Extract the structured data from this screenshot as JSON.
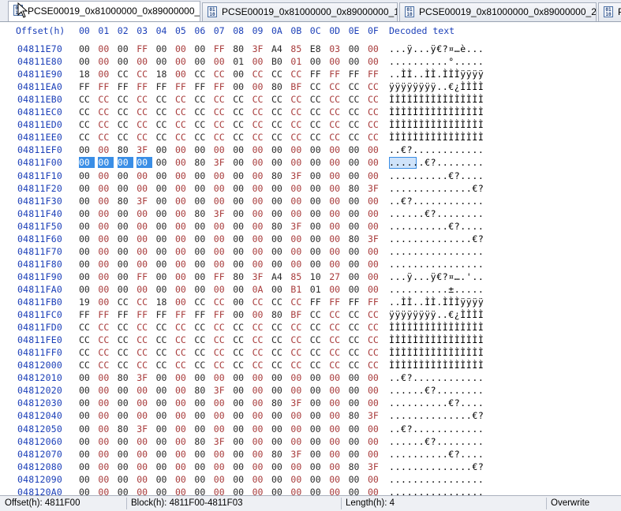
{
  "tabs": [
    {
      "label": "PCSE00019_0x81000000_0x89000000_0.bin",
      "active": true
    },
    {
      "label": "PCSE00019_0x81000000_0x89000000_1.bin",
      "active": false
    },
    {
      "label": "PCSE00019_0x81000000_0x89000000_2.bin",
      "active": false
    },
    {
      "label": "P",
      "active": false
    }
  ],
  "header": {
    "offset_label": "Offset(h)",
    "columns": [
      "00",
      "01",
      "02",
      "03",
      "04",
      "05",
      "06",
      "07",
      "08",
      "09",
      "0A",
      "0B",
      "0C",
      "0D",
      "0E",
      "0F"
    ],
    "decoded_label": "Decoded text"
  },
  "rows": [
    {
      "offset": "04811E70",
      "bytes": [
        "00",
        "00",
        "00",
        "FF",
        "00",
        "00",
        "00",
        "FF",
        "80",
        "3F",
        "A4",
        "85",
        "E8",
        "03",
        "00",
        "00"
      ],
      "text": "...ÿ...ÿ€?¤…è..."
    },
    {
      "offset": "04811E80",
      "bytes": [
        "00",
        "00",
        "00",
        "00",
        "00",
        "00",
        "00",
        "00",
        "01",
        "00",
        "B0",
        "01",
        "00",
        "00",
        "00",
        "00"
      ],
      "text": "..........°....."
    },
    {
      "offset": "04811E90",
      "bytes": [
        "18",
        "00",
        "CC",
        "CC",
        "18",
        "00",
        "CC",
        "CC",
        "00",
        "CC",
        "CC",
        "CC",
        "FF",
        "FF",
        "FF",
        "FF"
      ],
      "text": "..ÌÌ..ÌÌ.ÌÌÌÿÿÿÿ"
    },
    {
      "offset": "04811EA0",
      "bytes": [
        "FF",
        "FF",
        "FF",
        "FF",
        "FF",
        "FF",
        "FF",
        "FF",
        "00",
        "00",
        "80",
        "BF",
        "CC",
        "CC",
        "CC",
        "CC"
      ],
      "text": "ÿÿÿÿÿÿÿÿ..€¿ÌÌÌÌ"
    },
    {
      "offset": "04811EB0",
      "bytes": [
        "CC",
        "CC",
        "CC",
        "CC",
        "CC",
        "CC",
        "CC",
        "CC",
        "CC",
        "CC",
        "CC",
        "CC",
        "CC",
        "CC",
        "CC",
        "CC"
      ],
      "text": "ÌÌÌÌÌÌÌÌÌÌÌÌÌÌÌÌ"
    },
    {
      "offset": "04811EC0",
      "bytes": [
        "CC",
        "CC",
        "CC",
        "CC",
        "CC",
        "CC",
        "CC",
        "CC",
        "CC",
        "CC",
        "CC",
        "CC",
        "CC",
        "CC",
        "CC",
        "CC"
      ],
      "text": "ÌÌÌÌÌÌÌÌÌÌÌÌÌÌÌÌ"
    },
    {
      "offset": "04811ED0",
      "bytes": [
        "CC",
        "CC",
        "CC",
        "CC",
        "CC",
        "CC",
        "CC",
        "CC",
        "CC",
        "CC",
        "CC",
        "CC",
        "CC",
        "CC",
        "CC",
        "CC"
      ],
      "text": "ÌÌÌÌÌÌÌÌÌÌÌÌÌÌÌÌ"
    },
    {
      "offset": "04811EE0",
      "bytes": [
        "CC",
        "CC",
        "CC",
        "CC",
        "CC",
        "CC",
        "CC",
        "CC",
        "CC",
        "CC",
        "CC",
        "CC",
        "CC",
        "CC",
        "CC",
        "CC"
      ],
      "text": "ÌÌÌÌÌÌÌÌÌÌÌÌÌÌÌÌ"
    },
    {
      "offset": "04811EF0",
      "bytes": [
        "00",
        "00",
        "80",
        "3F",
        "00",
        "00",
        "00",
        "00",
        "00",
        "00",
        "00",
        "00",
        "00",
        "00",
        "00",
        "00"
      ],
      "text": "..€?............"
    },
    {
      "offset": "04811F00",
      "bytes": [
        "00",
        "00",
        "00",
        "00",
        "00",
        "00",
        "80",
        "3F",
        "00",
        "00",
        "00",
        "00",
        "00",
        "00",
        "00",
        "00"
      ],
      "text": "......€?........"
    },
    {
      "offset": "04811F10",
      "bytes": [
        "00",
        "00",
        "00",
        "00",
        "00",
        "00",
        "00",
        "00",
        "00",
        "00",
        "80",
        "3F",
        "00",
        "00",
        "00",
        "00"
      ],
      "text": "..........€?...."
    },
    {
      "offset": "04811F20",
      "bytes": [
        "00",
        "00",
        "00",
        "00",
        "00",
        "00",
        "00",
        "00",
        "00",
        "00",
        "00",
        "00",
        "00",
        "00",
        "80",
        "3F"
      ],
      "text": "..............€?"
    },
    {
      "offset": "04811F30",
      "bytes": [
        "00",
        "00",
        "80",
        "3F",
        "00",
        "00",
        "00",
        "00",
        "00",
        "00",
        "00",
        "00",
        "00",
        "00",
        "00",
        "00"
      ],
      "text": "..€?............"
    },
    {
      "offset": "04811F40",
      "bytes": [
        "00",
        "00",
        "00",
        "00",
        "00",
        "00",
        "80",
        "3F",
        "00",
        "00",
        "00",
        "00",
        "00",
        "00",
        "00",
        "00"
      ],
      "text": "......€?........"
    },
    {
      "offset": "04811F50",
      "bytes": [
        "00",
        "00",
        "00",
        "00",
        "00",
        "00",
        "00",
        "00",
        "00",
        "00",
        "80",
        "3F",
        "00",
        "00",
        "00",
        "00"
      ],
      "text": "..........€?...."
    },
    {
      "offset": "04811F60",
      "bytes": [
        "00",
        "00",
        "00",
        "00",
        "00",
        "00",
        "00",
        "00",
        "00",
        "00",
        "00",
        "00",
        "00",
        "00",
        "80",
        "3F"
      ],
      "text": "..............€?"
    },
    {
      "offset": "04811F70",
      "bytes": [
        "00",
        "00",
        "00",
        "00",
        "00",
        "00",
        "00",
        "00",
        "00",
        "00",
        "00",
        "00",
        "00",
        "00",
        "00",
        "00"
      ],
      "text": "................"
    },
    {
      "offset": "04811F80",
      "bytes": [
        "00",
        "00",
        "00",
        "00",
        "00",
        "00",
        "00",
        "00",
        "00",
        "00",
        "00",
        "00",
        "00",
        "00",
        "00",
        "00"
      ],
      "text": "................"
    },
    {
      "offset": "04811F90",
      "bytes": [
        "00",
        "00",
        "00",
        "FF",
        "00",
        "00",
        "00",
        "FF",
        "80",
        "3F",
        "A4",
        "85",
        "10",
        "27",
        "00",
        "00"
      ],
      "text": "...ÿ...ÿ€?¤….'.."
    },
    {
      "offset": "04811FA0",
      "bytes": [
        "00",
        "00",
        "00",
        "00",
        "00",
        "00",
        "00",
        "00",
        "00",
        "0A",
        "00",
        "B1",
        "01",
        "00",
        "00",
        "00"
      ],
      "text": "..........±....."
    },
    {
      "offset": "04811FB0",
      "bytes": [
        "19",
        "00",
        "CC",
        "CC",
        "18",
        "00",
        "CC",
        "CC",
        "00",
        "CC",
        "CC",
        "CC",
        "FF",
        "FF",
        "FF",
        "FF"
      ],
      "text": "..ÌÌ..ÌÌ.ÌÌÌÿÿÿÿ"
    },
    {
      "offset": "04811FC0",
      "bytes": [
        "FF",
        "FF",
        "FF",
        "FF",
        "FF",
        "FF",
        "FF",
        "FF",
        "00",
        "00",
        "80",
        "BF",
        "CC",
        "CC",
        "CC",
        "CC"
      ],
      "text": "ÿÿÿÿÿÿÿÿ..€¿ÌÌÌÌ"
    },
    {
      "offset": "04811FD0",
      "bytes": [
        "CC",
        "CC",
        "CC",
        "CC",
        "CC",
        "CC",
        "CC",
        "CC",
        "CC",
        "CC",
        "CC",
        "CC",
        "CC",
        "CC",
        "CC",
        "CC"
      ],
      "text": "ÌÌÌÌÌÌÌÌÌÌÌÌÌÌÌÌ"
    },
    {
      "offset": "04811FE0",
      "bytes": [
        "CC",
        "CC",
        "CC",
        "CC",
        "CC",
        "CC",
        "CC",
        "CC",
        "CC",
        "CC",
        "CC",
        "CC",
        "CC",
        "CC",
        "CC",
        "CC"
      ],
      "text": "ÌÌÌÌÌÌÌÌÌÌÌÌÌÌÌÌ"
    },
    {
      "offset": "04811FF0",
      "bytes": [
        "CC",
        "CC",
        "CC",
        "CC",
        "CC",
        "CC",
        "CC",
        "CC",
        "CC",
        "CC",
        "CC",
        "CC",
        "CC",
        "CC",
        "CC",
        "CC"
      ],
      "text": "ÌÌÌÌÌÌÌÌÌÌÌÌÌÌÌÌ"
    },
    {
      "offset": "04812000",
      "bytes": [
        "CC",
        "CC",
        "CC",
        "CC",
        "CC",
        "CC",
        "CC",
        "CC",
        "CC",
        "CC",
        "CC",
        "CC",
        "CC",
        "CC",
        "CC",
        "CC"
      ],
      "text": "ÌÌÌÌÌÌÌÌÌÌÌÌÌÌÌÌ"
    },
    {
      "offset": "04812010",
      "bytes": [
        "00",
        "00",
        "80",
        "3F",
        "00",
        "00",
        "00",
        "00",
        "00",
        "00",
        "00",
        "00",
        "00",
        "00",
        "00",
        "00"
      ],
      "text": "..€?............"
    },
    {
      "offset": "04812020",
      "bytes": [
        "00",
        "00",
        "00",
        "00",
        "00",
        "00",
        "80",
        "3F",
        "00",
        "00",
        "00",
        "00",
        "00",
        "00",
        "00",
        "00"
      ],
      "text": "......€?........"
    },
    {
      "offset": "04812030",
      "bytes": [
        "00",
        "00",
        "00",
        "00",
        "00",
        "00",
        "00",
        "00",
        "00",
        "00",
        "80",
        "3F",
        "00",
        "00",
        "00",
        "00"
      ],
      "text": "..........€?...."
    },
    {
      "offset": "04812040",
      "bytes": [
        "00",
        "00",
        "00",
        "00",
        "00",
        "00",
        "00",
        "00",
        "00",
        "00",
        "00",
        "00",
        "00",
        "00",
        "80",
        "3F"
      ],
      "text": "..............€?"
    },
    {
      "offset": "04812050",
      "bytes": [
        "00",
        "00",
        "80",
        "3F",
        "00",
        "00",
        "00",
        "00",
        "00",
        "00",
        "00",
        "00",
        "00",
        "00",
        "00",
        "00"
      ],
      "text": "..€?............"
    },
    {
      "offset": "04812060",
      "bytes": [
        "00",
        "00",
        "00",
        "00",
        "00",
        "00",
        "80",
        "3F",
        "00",
        "00",
        "00",
        "00",
        "00",
        "00",
        "00",
        "00"
      ],
      "text": "......€?........"
    },
    {
      "offset": "04812070",
      "bytes": [
        "00",
        "00",
        "00",
        "00",
        "00",
        "00",
        "00",
        "00",
        "00",
        "00",
        "80",
        "3F",
        "00",
        "00",
        "00",
        "00"
      ],
      "text": "..........€?...."
    },
    {
      "offset": "04812080",
      "bytes": [
        "00",
        "00",
        "00",
        "00",
        "00",
        "00",
        "00",
        "00",
        "00",
        "00",
        "00",
        "00",
        "00",
        "00",
        "80",
        "3F"
      ],
      "text": "..............€?"
    },
    {
      "offset": "04812090",
      "bytes": [
        "00",
        "00",
        "00",
        "00",
        "00",
        "00",
        "00",
        "00",
        "00",
        "00",
        "00",
        "00",
        "00",
        "00",
        "00",
        "00"
      ],
      "text": "................"
    },
    {
      "offset": "048120A0",
      "bytes": [
        "00",
        "00",
        "00",
        "00",
        "00",
        "00",
        "00",
        "00",
        "00",
        "00",
        "00",
        "00",
        "00",
        "00",
        "00",
        "00"
      ],
      "text": "................"
    }
  ],
  "selection": {
    "row": 9,
    "start": 0,
    "end": 3
  },
  "status": {
    "offset": "Offset(h): 4811F00",
    "block": "Block(h): 4811F00-4811F03",
    "length": "Length(h): 4",
    "mode": "Overwrite"
  },
  "colors": {
    "offset_blue": "#1b3fb8",
    "selection": "#3a8ee6",
    "alt_byte": "#a83b3b"
  },
  "icons": {
    "tab": "binary-file-icon",
    "pointer": "mouse-cursor-icon"
  }
}
